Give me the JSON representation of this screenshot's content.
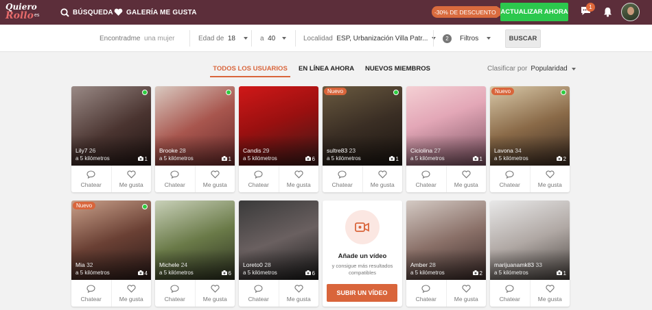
{
  "header": {
    "logo_line1": "Quiero",
    "logo_line2": "Rollo",
    "logo_suffix": "es",
    "nav": [
      {
        "label": "BÚSQUEDA",
        "icon": "search-icon"
      },
      {
        "label": "GALERÍA ME GUSTA",
        "icon": "heart-icon"
      }
    ],
    "discount": "-30% DE DESCUENTO",
    "upgrade_label": "ACTUALIZAR AHORA",
    "chat_badge": "1",
    "colors": {
      "bar": "#5c2e3a",
      "accent": "#d9653b",
      "upgrade": "#2cc84d"
    }
  },
  "filters": {
    "find_label": "Encontradme",
    "find_value": "una mujer",
    "age_label": "Edad de",
    "age_from": "18",
    "age_to_label": "a",
    "age_to": "40",
    "location_label": "Localidad",
    "location_value": "ESP, Urbanización Villa Patr...",
    "filters_count": "2",
    "filters_label": "Filtros",
    "search_button": "BUSCAR"
  },
  "tabs": [
    {
      "label": "TODOS LOS USUARIOS",
      "active": true
    },
    {
      "label": "EN LÍNEA AHORA",
      "active": false
    },
    {
      "label": "NUEVOS MIEMBROS",
      "active": false
    }
  ],
  "sort": {
    "label": "Clasificar por",
    "value": "Popularidad"
  },
  "card_actions": {
    "chat": "Chatear",
    "like": "Me gusta"
  },
  "profiles": [
    {
      "name": "Lily7",
      "age": "26",
      "distance": "a 5 kilómetros",
      "photos": "1",
      "online": true,
      "new": false
    },
    {
      "name": "Brooke",
      "age": "28",
      "distance": "a 5 kilómetros",
      "photos": "1",
      "online": true,
      "new": false
    },
    {
      "name": "Candis",
      "age": "29",
      "distance": "a 5 kilómetros",
      "photos": "6",
      "online": false,
      "new": false
    },
    {
      "name": "sultre83",
      "age": "23",
      "distance": "a 5 kilómetros",
      "photos": "1",
      "online": true,
      "new": true
    },
    {
      "name": "Ciciolina",
      "age": "27",
      "distance": "a 5 kilómetros",
      "photos": "1",
      "online": false,
      "new": false
    },
    {
      "name": "Lavona",
      "age": "34",
      "distance": "a 5 kilómetros",
      "photos": "2",
      "online": true,
      "new": true
    },
    {
      "name": "Mia",
      "age": "32",
      "distance": "a 5 kilómetros",
      "photos": "4",
      "online": true,
      "new": true
    },
    {
      "name": "Michele",
      "age": "24",
      "distance": "a 5 kilómetros",
      "photos": "6",
      "online": false,
      "new": false
    },
    {
      "name": "Loreto0",
      "age": "28",
      "distance": "a 5 kilómetros",
      "photos": "6",
      "online": false,
      "new": false
    },
    {
      "name": "Amber",
      "age": "28",
      "distance": "a 5 kilómetros",
      "photos": "2",
      "online": false,
      "new": false
    },
    {
      "name": "marijuanamk83",
      "age": "33",
      "distance": "a 5 kilómetros",
      "photos": "1",
      "online": false,
      "new": false
    }
  ],
  "nuevo_label": "Nuevo",
  "video_card": {
    "title": "Añade un vídeo",
    "subtitle": "y consigue más resultados compatibles",
    "button": "SUBIR UN VÍDEO"
  }
}
